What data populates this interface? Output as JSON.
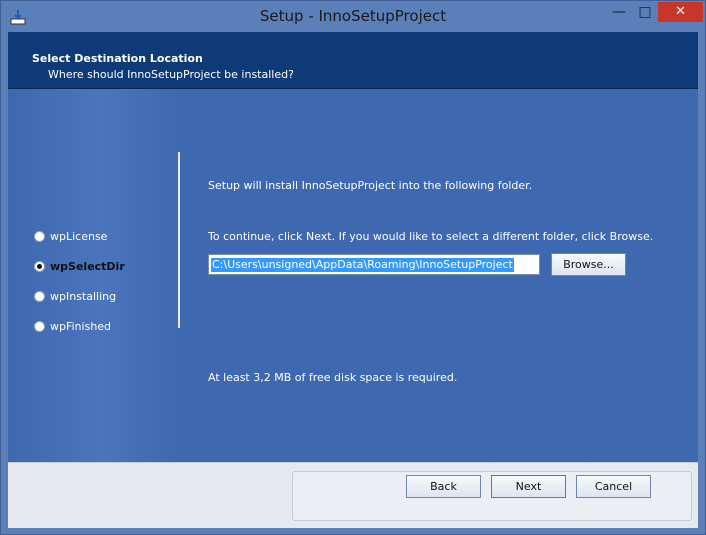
{
  "window": {
    "title": "Setup - InnoSetupProject"
  },
  "titlebar": {
    "minimize": "—",
    "maximize": "□",
    "close": "✕"
  },
  "header": {
    "title": "Select Destination Location",
    "subtitle": "Where should InnoSetupProject be installed?"
  },
  "pages": [
    {
      "label": "wpLicense",
      "selected": false
    },
    {
      "label": "wpSelectDir",
      "selected": true
    },
    {
      "label": "wpInstalling",
      "selected": false
    },
    {
      "label": "wpFinished",
      "selected": false
    }
  ],
  "content": {
    "intro": "Setup will install InnoSetupProject into the following folder.",
    "instruction": "To continue, click Next. If you would like to select a different folder, click Browse.",
    "directory": "C:\\Users\\unsigned\\AppData\\Roaming\\InnoSetupProject",
    "browse_label": "Browse...",
    "disk_space": "At least 3,2 MB of free disk space is required."
  },
  "footer": {
    "back": "Back",
    "next": "Next",
    "cancel": "Cancel"
  },
  "colors": {
    "accent": "#0f3a78",
    "page_bg": "#3e68b0",
    "close_button": "#c7362b"
  },
  "icons": {
    "app": "setup-installer-icon"
  }
}
